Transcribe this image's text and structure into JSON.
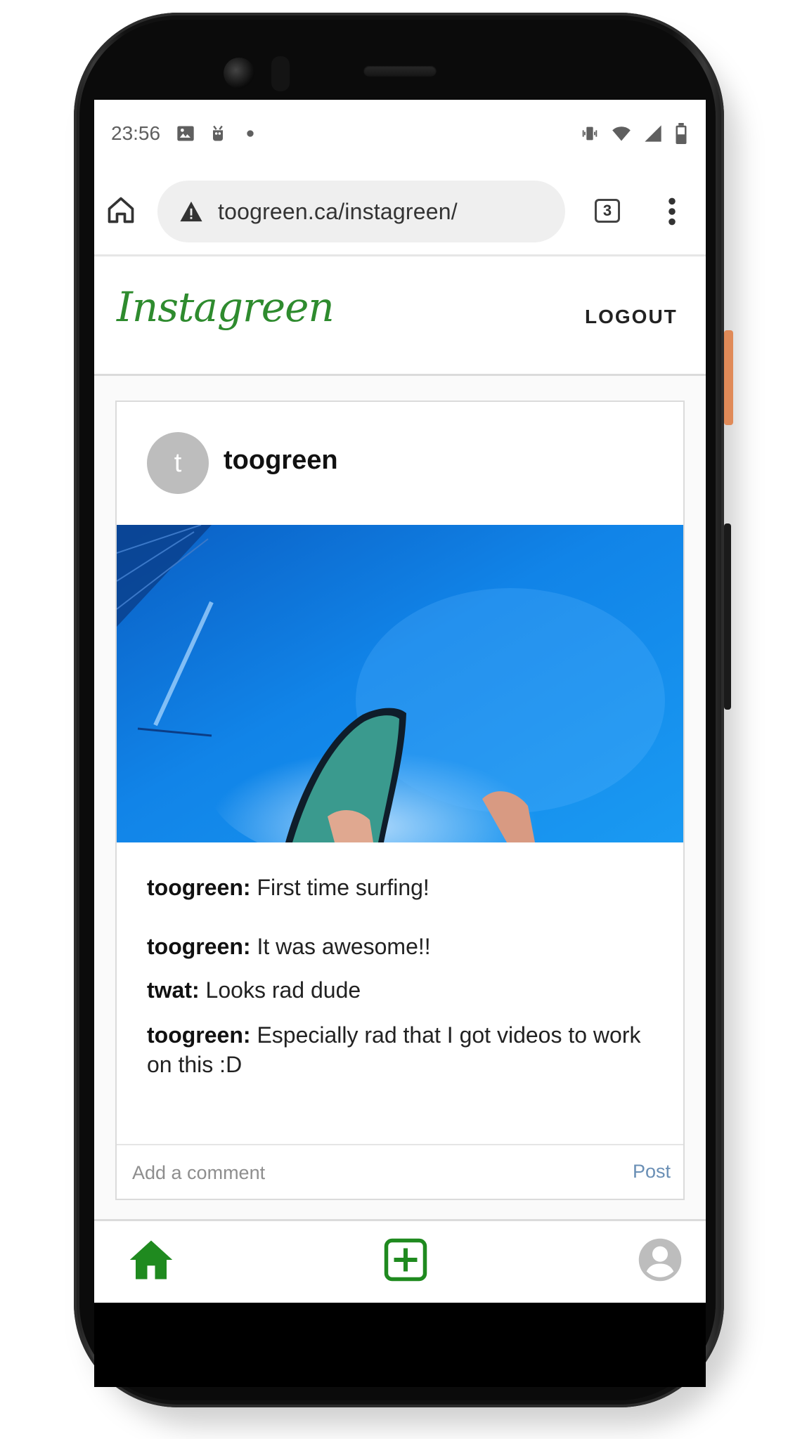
{
  "status_bar": {
    "time": "23:56",
    "left_icons": [
      "image-icon",
      "android-debug-icon",
      "dot-icon"
    ],
    "right_icons": [
      "vibrate-icon",
      "wifi-icon",
      "signal-icon",
      "battery-icon"
    ]
  },
  "browser": {
    "url": "toogreen.ca/instagreen/",
    "tab_count": "3",
    "icons": [
      "home-icon",
      "warning-icon",
      "tabs-icon",
      "more-vert-icon"
    ]
  },
  "app": {
    "logo": "Instagreen",
    "logout_label": "LOGOUT"
  },
  "post": {
    "avatar_letter": "t",
    "username": "toogreen",
    "media_description_icon": "surf-video",
    "comments": [
      {
        "user": "toogreen:",
        "text": " First time surfing!"
      },
      {
        "user": "toogreen:",
        "text": " It was awesome!!"
      },
      {
        "user": "twat:",
        "text": " Looks rad dude"
      },
      {
        "user": "toogreen:",
        "text": " Especially rad that I got videos to work on this :D"
      }
    ],
    "comment_placeholder": "Add a comment",
    "post_label": "Post"
  },
  "bottom_nav": {
    "icons": [
      "home-icon",
      "add-post-icon",
      "profile-icon"
    ]
  },
  "colors": {
    "brand_green": "#2e8b2e",
    "post_link": "#6a8fb5"
  }
}
